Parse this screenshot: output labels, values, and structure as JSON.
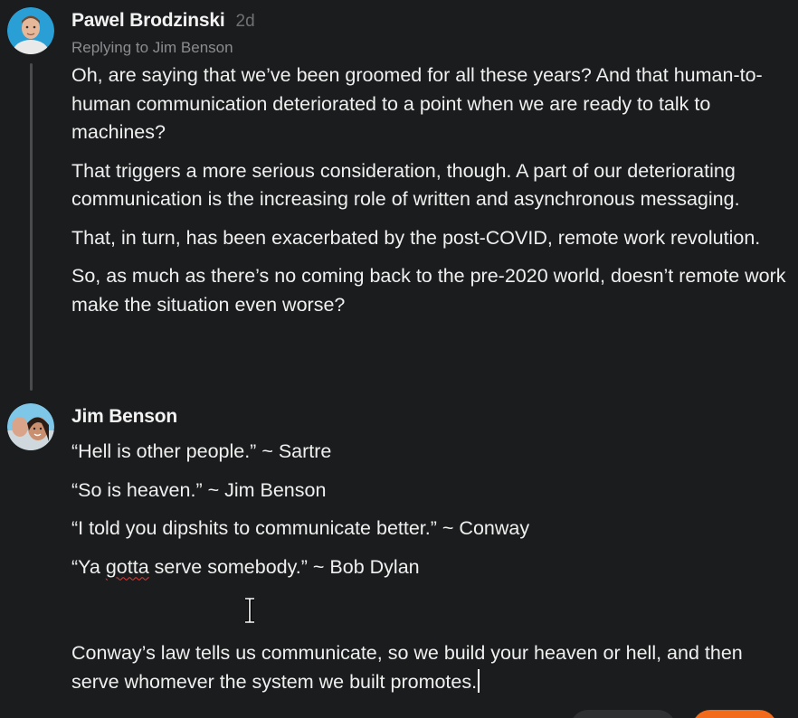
{
  "comment_1": {
    "author": "Pawel Brodzinski",
    "timestamp": "2d",
    "reply_to": "Replying to Jim Benson",
    "paragraphs": [
      "Oh, are saying that we’ve been groomed for all these years? And that human-to-human communication deteriorated to a point when we are ready to talk to machines?",
      "That triggers a more serious consideration, though. A part of our deteriorating communication is the increasing role of written and asynchronous messaging.",
      "That, in turn, has been exacerbated by the post-COVID, remote work revolution.",
      "So, as much as there’s no coming back to the pre-2020 world, doesn’t remote work make the situation even worse?"
    ]
  },
  "comment_2": {
    "author": "Jim Benson",
    "line_1": "“Hell is other people.” ~ Sartre",
    "line_2": "“So is heaven.” ~ Jim Benson",
    "line_3": "“I told you dipshits to communicate better.” ~ Conway",
    "line_4_prefix": "“Ya ",
    "line_4_misspelled": "gotta",
    "line_4_suffix": " serve somebody.” ~ Bob Dylan",
    "line_5": "Conway’s law tells us communicate, so we build your heaven or hell, and then serve whomever the system we built promotes."
  },
  "icons": {
    "avatar_1": "avatar-photo",
    "avatar_2": "avatar-photo",
    "text_cursor": "i-beam-cursor-icon"
  },
  "colors": {
    "background": "#1b1c1d",
    "text": "#f0f0f0",
    "muted": "#8a8c8f",
    "thread_line": "#4a4b4d",
    "spellcheck": "#e53935",
    "accent": "#f26a1b"
  }
}
